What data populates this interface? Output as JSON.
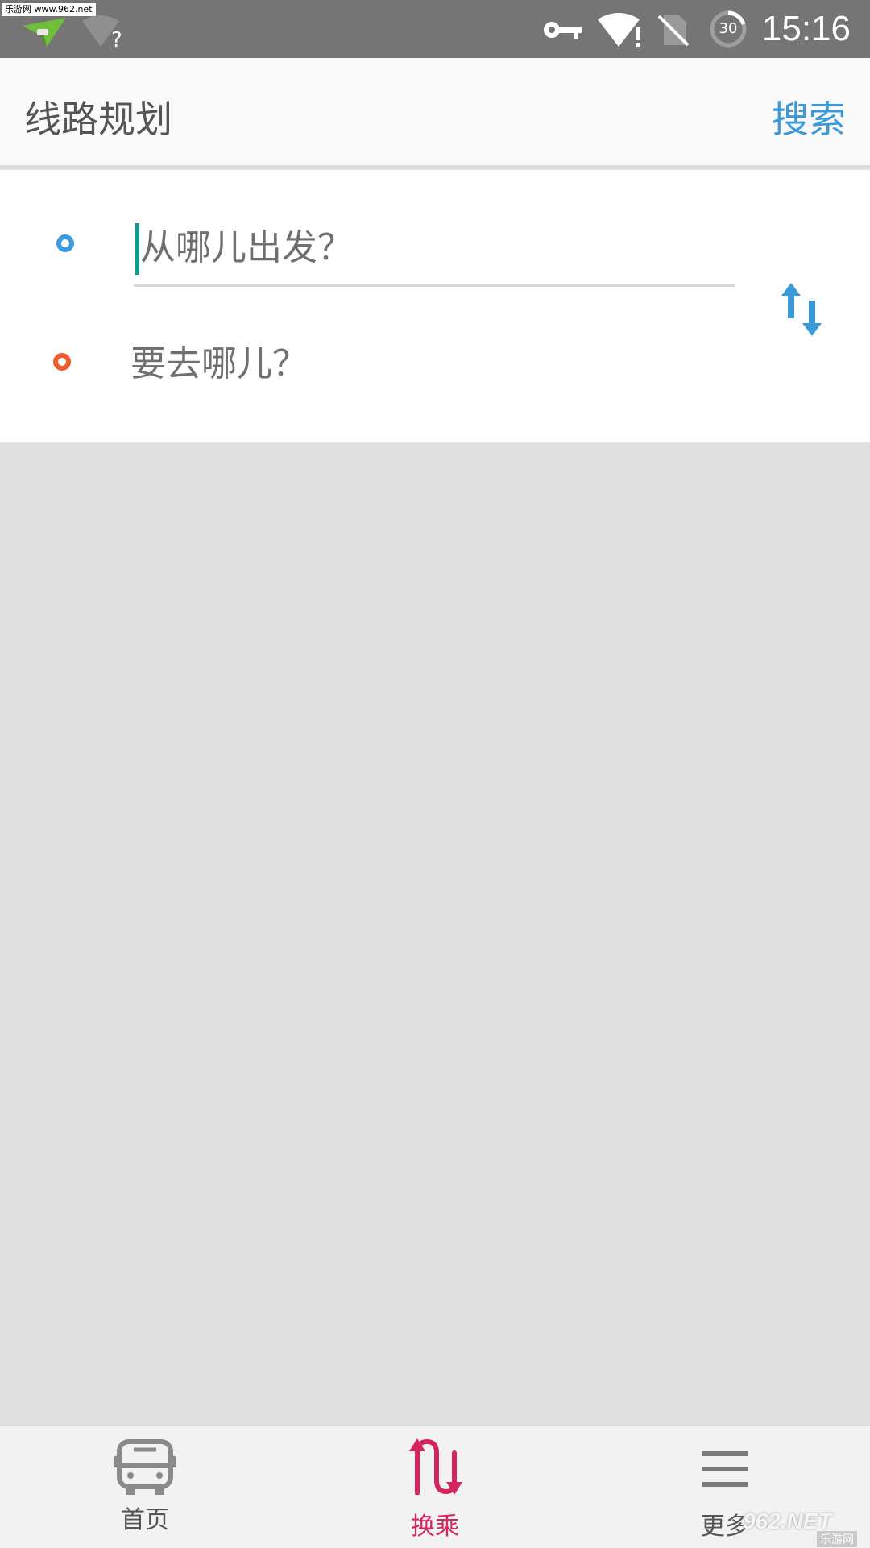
{
  "status_bar": {
    "watermark": "乐游网 www.962.net",
    "time": "15:16",
    "battery_level": "30"
  },
  "header": {
    "title": "线路规划",
    "search_label": "搜索"
  },
  "route": {
    "start_placeholder": "从哪儿出发？",
    "end_placeholder": "要去哪儿？"
  },
  "tabs": [
    {
      "label": "首页",
      "active": false
    },
    {
      "label": "换乘",
      "active": true
    },
    {
      "label": "更多",
      "active": false
    }
  ],
  "watermark_bottom": {
    "brand": "962.NET",
    "sub": "乐游网"
  },
  "colors": {
    "accent_blue": "#3a9ad9",
    "start_dot": "#3d9ae0",
    "end_dot": "#ef5a2e",
    "active_tab": "#d6245c",
    "cursor": "#129a8f"
  }
}
